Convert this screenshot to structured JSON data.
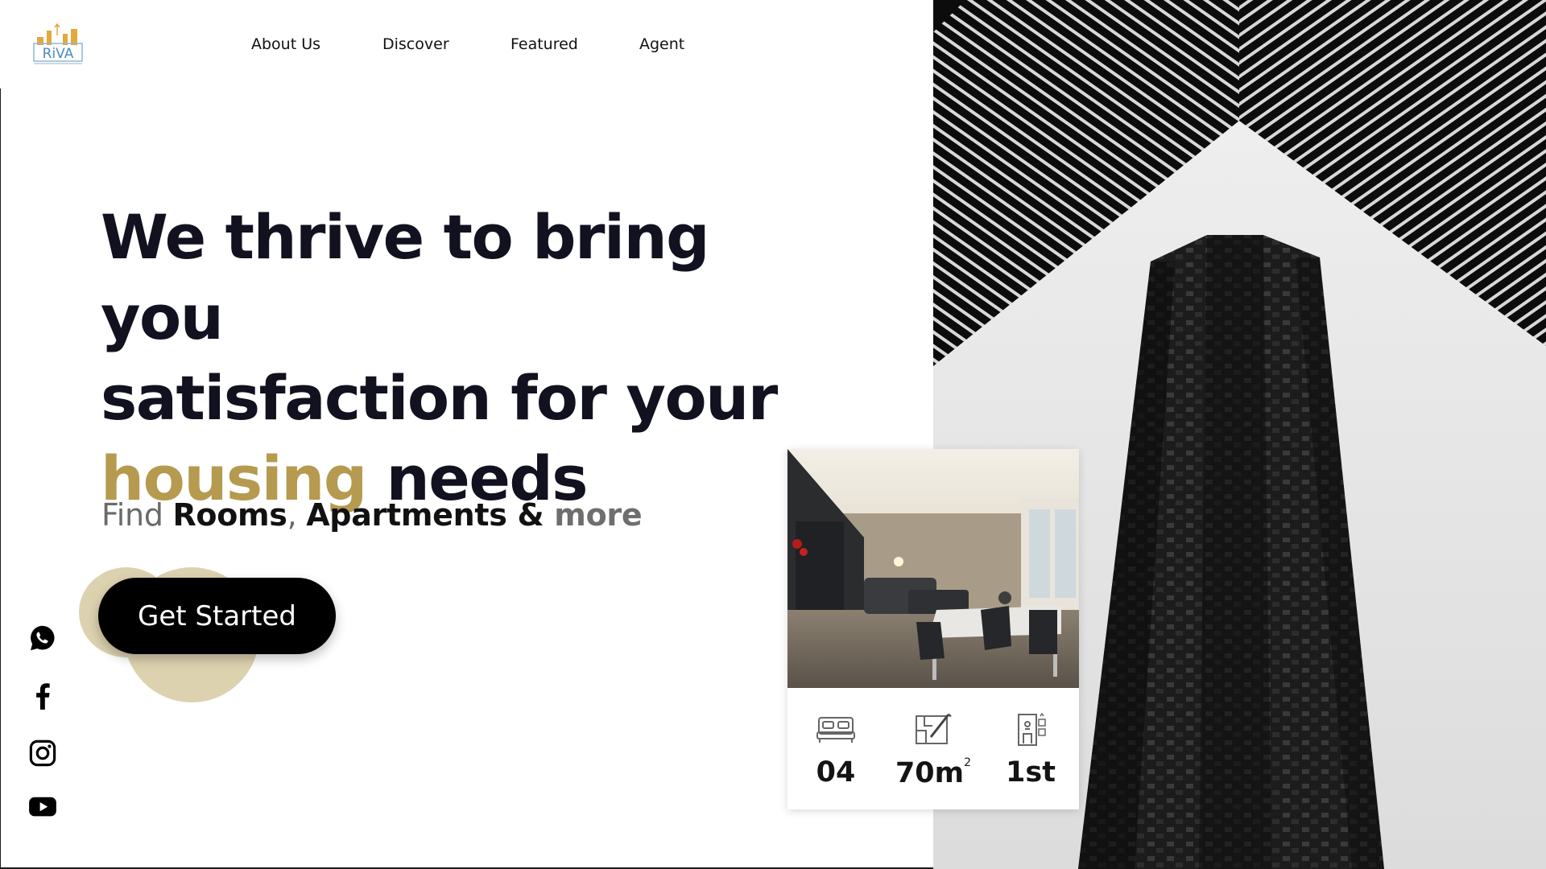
{
  "brand": {
    "logo_text": "RiVA",
    "logo_icon": "city-skyline-logo",
    "colors": {
      "accent": "#b59a4f",
      "blob": "#ddd2b0",
      "dark": "#11111f"
    }
  },
  "nav": {
    "items": [
      {
        "label": "About Us"
      },
      {
        "label": "Discover"
      },
      {
        "label": "Featured"
      },
      {
        "label": "Agent"
      }
    ]
  },
  "hero": {
    "headline": {
      "line1": "We thrive to bring you",
      "line2": "satisfaction for your",
      "line3_accent": "housing",
      "line3_rest": " needs"
    },
    "subline": {
      "find": "Find ",
      "rooms": "Rooms",
      "comma": ", ",
      "apartments": "Apartments",
      "amp": " & ",
      "more": "more"
    },
    "cta_label": "Get Started"
  },
  "social": [
    {
      "icon": "whatsapp-icon"
    },
    {
      "icon": "facebook-icon"
    },
    {
      "icon": "instagram-icon"
    },
    {
      "icon": "youtube-icon"
    }
  ],
  "property_card": {
    "stats": [
      {
        "icon": "bed-icon",
        "value": "04"
      },
      {
        "icon": "floorplan-icon",
        "value": "70m",
        "sup": "2"
      },
      {
        "icon": "elevator-icon",
        "value": "1st"
      }
    ]
  }
}
